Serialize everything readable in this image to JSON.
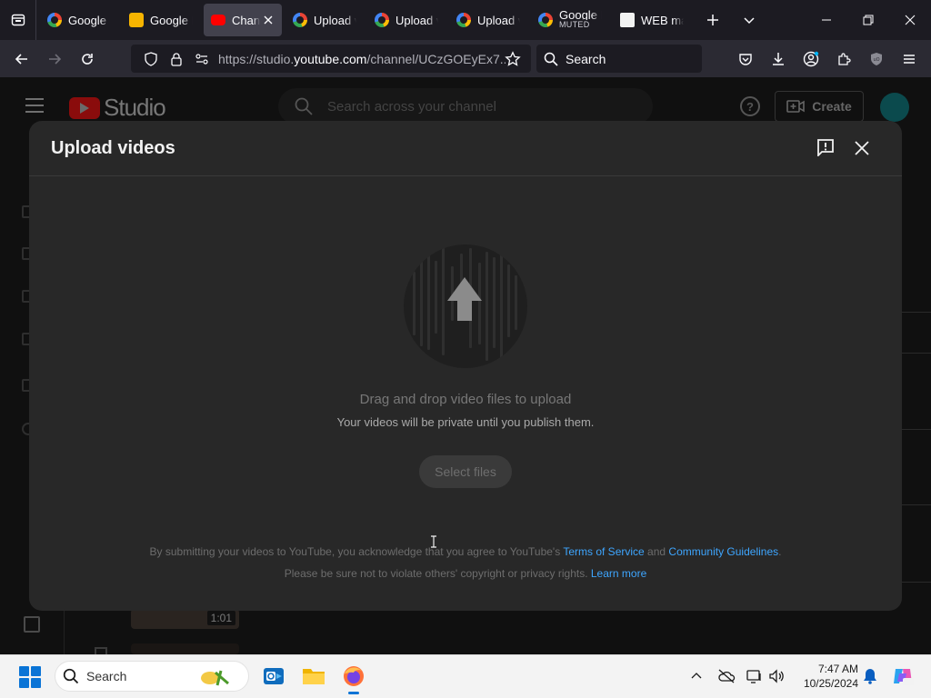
{
  "browser": {
    "tabs": [
      {
        "title": "Google",
        "icon": "google-icon",
        "active": false
      },
      {
        "title": "Google Keep",
        "icon": "keep-icon",
        "active": false
      },
      {
        "title": "Channel content - YouTube Studio",
        "icon": "youtube-icon",
        "active": true
      },
      {
        "title": "Upload videos",
        "icon": "google-icon",
        "active": false
      },
      {
        "title": "Upload videos",
        "icon": "google-icon",
        "active": false
      },
      {
        "title": "Upload videos",
        "icon": "google-icon",
        "active": false
      },
      {
        "title": "Google Meet",
        "subtitle": "MUTED",
        "icon": "google-icon",
        "active": false
      },
      {
        "title": "WEB macro",
        "icon": "web-icon",
        "active": false
      }
    ],
    "url_prefix": "https://studio.",
    "url_domain": "youtube.com",
    "url_path": "/channel/UCzGOEyEx7...",
    "search_placeholder": "Search"
  },
  "studio": {
    "logo_text": "Studio",
    "search_placeholder": "Search across your channel",
    "create_label": "Create",
    "help_icon": "?",
    "video_duration": "1:01"
  },
  "modal": {
    "title": "Upload videos",
    "drag_text": "Drag and drop video files to upload",
    "private_text": "Your videos will be private until you publish them.",
    "select_button": "Select files",
    "legal_line1_prefix": "By submitting your videos to YouTube, you acknowledge that you agree to YouTube's ",
    "terms_link": "Terms of Service",
    "legal_and": " and ",
    "guidelines_link": "Community Guidelines",
    "legal_period": ".",
    "legal_line2_prefix": "Please be sure not to violate others' copyright or privacy rights. ",
    "learn_more": "Learn more"
  },
  "taskbar": {
    "search_label": "Search",
    "time": "7:47 AM",
    "date": "10/25/2024"
  },
  "colors": {
    "link": "#3ea6ff",
    "modal_bg": "#282828",
    "accent_blue": "#0a74d6"
  }
}
